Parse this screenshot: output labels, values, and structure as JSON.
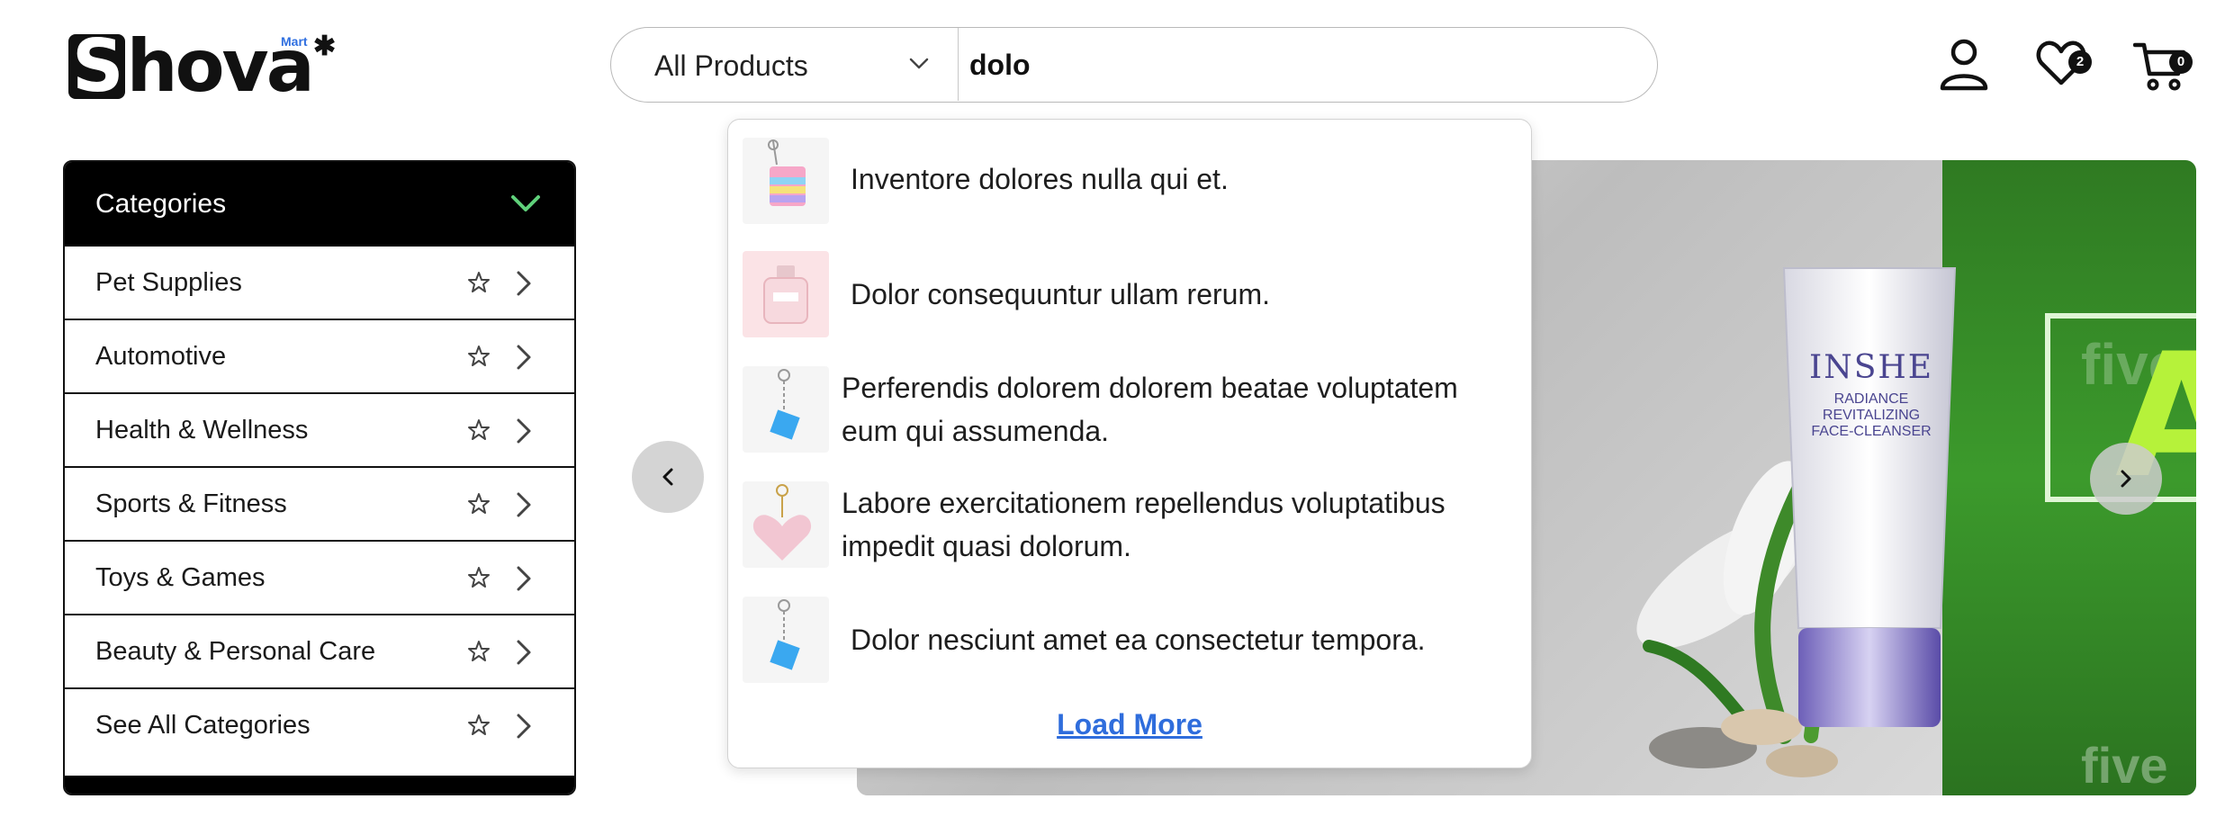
{
  "brand": {
    "name": "Shova",
    "sub": "Mart"
  },
  "search": {
    "category_selected": "All Products",
    "query": "dolo"
  },
  "header_icons": {
    "wishlist_count": "2",
    "cart_count": "0"
  },
  "categories": {
    "title": "Categories",
    "items": [
      {
        "label": "Pet Supplies"
      },
      {
        "label": "Automotive"
      },
      {
        "label": "Health & Wellness"
      },
      {
        "label": "Sports & Fitness"
      },
      {
        "label": "Toys & Games"
      },
      {
        "label": "Beauty & Personal Care"
      },
      {
        "label": "See All Categories"
      }
    ]
  },
  "search_results": {
    "items": [
      {
        "title": "Inventore dolores nulla qui et.",
        "thumb": "rainbow-bag-keychain"
      },
      {
        "title": "Dolor consequuntur ullam rerum.",
        "thumb": "perfume-bottle"
      },
      {
        "title_line1": "Perferendis dolorem dolorem beatae voluptatem",
        "title_line2": "eum qui assumenda.",
        "thumb": "blue-cube-keychain"
      },
      {
        "title_line1": "Labore exercitationem repellendus voluptatibus",
        "title_line2": "impedit quasi dolorum.",
        "thumb": "pink-heart-keychain"
      },
      {
        "title": "Dolor nesciunt amet ea consectetur tempora.",
        "thumb": "blue-cube-keychain"
      }
    ],
    "load_more_label": "Load More"
  },
  "hero": {
    "product_brand": "INSHE",
    "product_line1": "RADIANCE",
    "product_line2": "REVITALIZING",
    "product_line3": "FACE-CLEANSER",
    "side_letter": "A",
    "watermark": "five"
  },
  "colors": {
    "accent_link": "#2f6ddc",
    "category_chevron": "#5fd07a",
    "hero_green": "#3c9a2c"
  }
}
